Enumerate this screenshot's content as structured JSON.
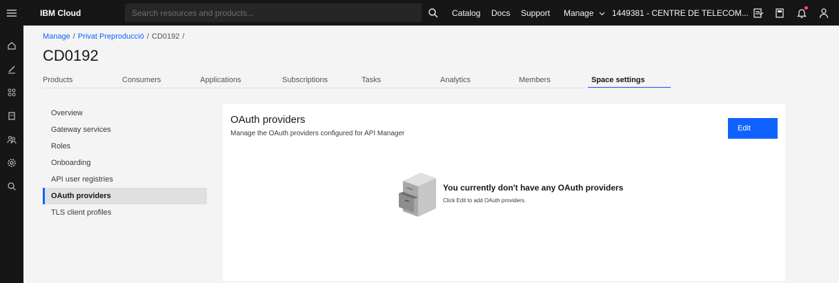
{
  "topbar": {
    "brand": "IBM Cloud",
    "search_placeholder": "Search resources and products...",
    "nav": {
      "catalog": "Catalog",
      "docs": "Docs",
      "support": "Support",
      "manage": "Manage",
      "account": "1449381 - CENTRE DE TELECOM..."
    },
    "icons": [
      "menu-icon",
      "search-icon",
      "chevron-down-icon",
      "cost-estimator-icon",
      "calculator-icon",
      "notification-icon",
      "user-icon"
    ],
    "notification_dot_color": "#fa4d56"
  },
  "left_rail": {
    "icons": [
      "home-icon",
      "edit-icon",
      "apps-icon",
      "catalog-icon",
      "members-icon",
      "settings-icon",
      "search-icon"
    ]
  },
  "breadcrumb": {
    "items": [
      "Manage",
      "Privat Preproducció",
      "CD0192"
    ]
  },
  "page": {
    "title": "CD0192"
  },
  "tabs": {
    "items": [
      "Products",
      "Consumers",
      "Applications",
      "Subscriptions",
      "Tasks",
      "Analytics",
      "Members",
      "Space settings"
    ],
    "active": "Space settings"
  },
  "sidenav": {
    "items": [
      "Overview",
      "Gateway services",
      "Roles",
      "Onboarding",
      "API user registries",
      "OAuth providers",
      "TLS client profiles"
    ],
    "active": "OAuth providers"
  },
  "panel": {
    "title": "OAuth providers",
    "description": "Manage the OAuth providers configured for API Manager",
    "edit_button": "Edit",
    "empty_title": "You currently don't have any OAuth providers",
    "empty_description": "Click Edit to add OAuth providers."
  },
  "colors": {
    "accent": "#0f62fe",
    "topbar_bg": "#161616",
    "page_bg": "#f4f4f4"
  }
}
